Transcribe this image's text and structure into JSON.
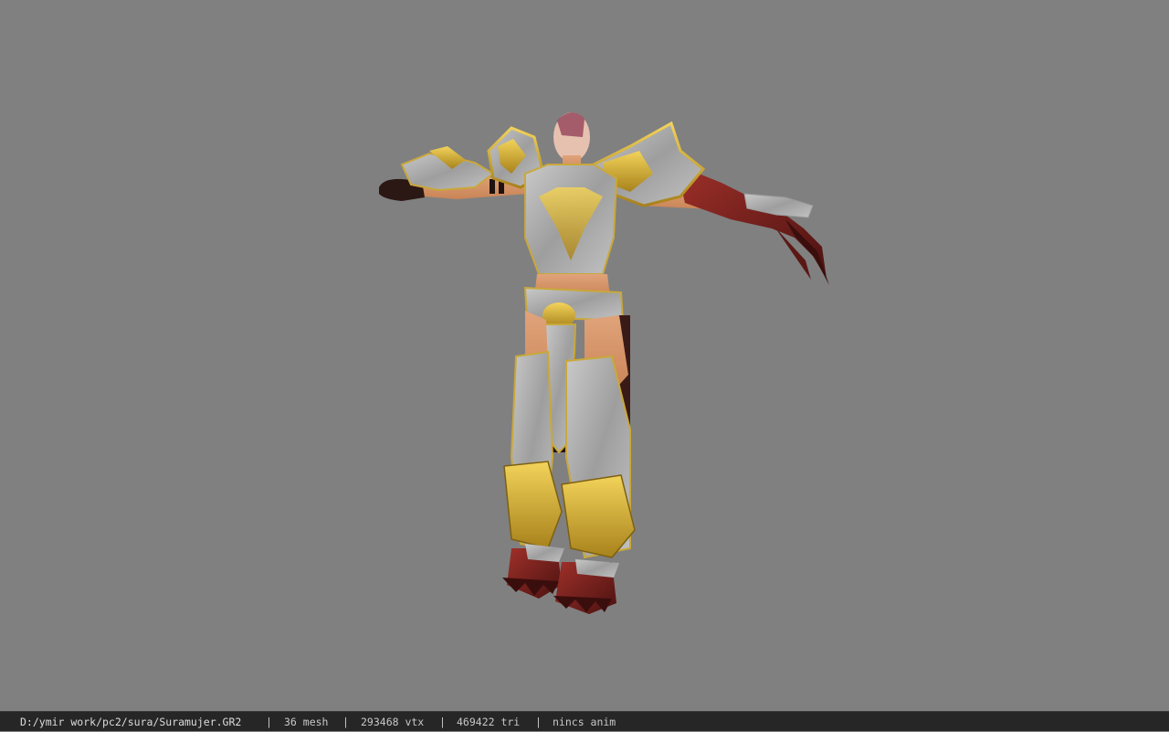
{
  "viewer": {
    "background_color": "#808080"
  },
  "status_bar": {
    "file_path": "D:/ymir work/pc2/sura/Suramujer.GR2",
    "separator": "|",
    "mesh_count": "36 mesh",
    "vertex_count": "293468 vtx",
    "triangle_count": "469422 tri",
    "animation": "nincs anim"
  },
  "model": {
    "icon": "character-model-t-pose",
    "colors": {
      "armor_silver": "#a9a9a9",
      "armor_gold": "#d4b23a",
      "skin": "#d9966a",
      "claw_red": "#7a1e1a",
      "leather_dark": "#2a1614"
    }
  }
}
